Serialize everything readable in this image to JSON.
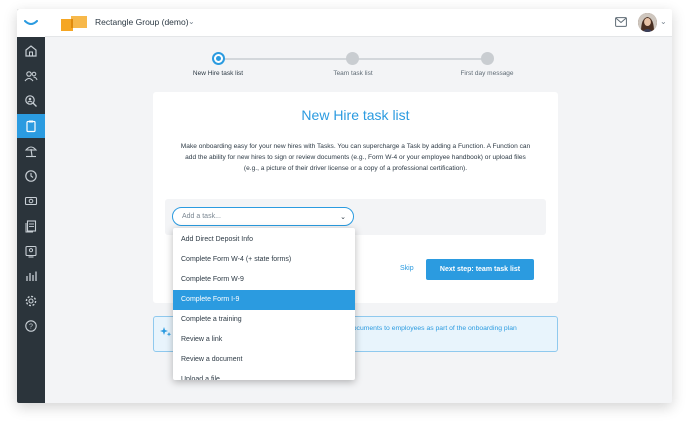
{
  "topbar": {
    "company_name": "Rectangle Group (demo)",
    "company_chevron": "⌄",
    "mail_icon": "mail-icon",
    "avatar_chevron": "⌄"
  },
  "sidebar": {
    "items": [
      {
        "icon": "home-icon"
      },
      {
        "icon": "people-icon"
      },
      {
        "icon": "search-person-icon"
      },
      {
        "icon": "clipboard-icon"
      },
      {
        "icon": "beach-icon"
      },
      {
        "icon": "clock-icon"
      },
      {
        "icon": "money-icon"
      },
      {
        "icon": "documents-icon"
      },
      {
        "icon": "badge-icon"
      },
      {
        "icon": "reports-icon"
      },
      {
        "icon": "settings-icon"
      },
      {
        "icon": "help-icon"
      }
    ],
    "active_index": 3
  },
  "stepper": {
    "steps": [
      {
        "label": "New Hire task list",
        "active": true
      },
      {
        "label": "Team task list",
        "active": false
      },
      {
        "label": "First day message",
        "active": false
      }
    ]
  },
  "card": {
    "title": "New Hire task list",
    "description": "Make onboarding easy for your new hires with Tasks. You can supercharge a Task by adding a Function. A Function can add the ability for new hires to sign or review documents (e.g., Form W-4 or your employee handbook) or upload files (e.g., a picture of their driver license or a copy of a professional certification).",
    "add_task_placeholder": "Add a task...",
    "skip_label": "Skip",
    "next_label": "Next step: team task list"
  },
  "banner": {
    "text": "documents to employees as part of the onboarding plan"
  },
  "dropdown": {
    "options": [
      "Add Direct Deposit Info",
      "Complete Form W-4 (+ state forms)",
      "Complete Form W-9",
      "Complete Form I-9",
      "Complete a training",
      "Review a link",
      "Review a document",
      "Upload a file"
    ],
    "selected_index": 3
  },
  "colors": {
    "accent": "#2b9be0",
    "sidebar": "#2b343b",
    "text": "#2d3a45",
    "brand_orange": "#f5a623"
  }
}
